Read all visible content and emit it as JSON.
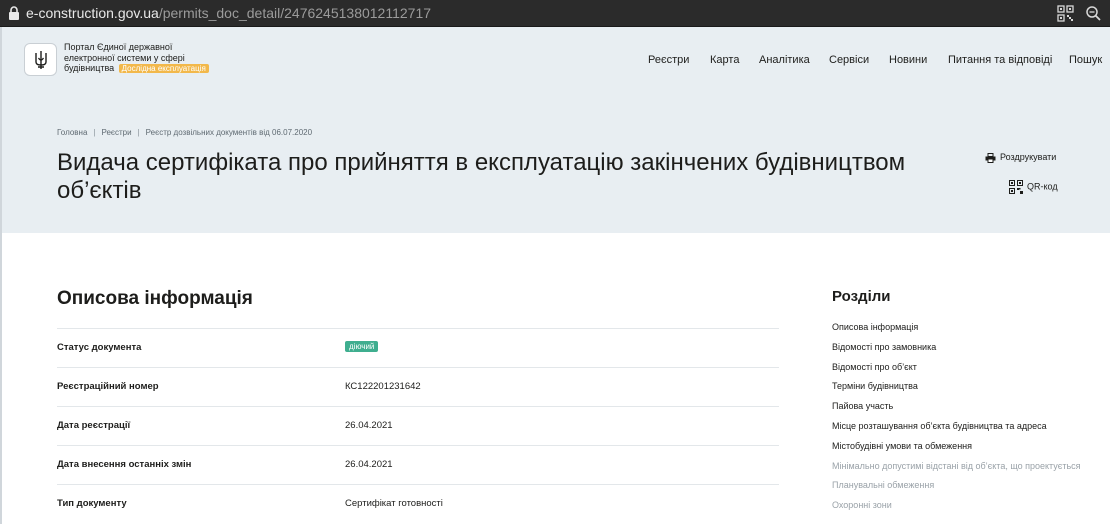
{
  "browser": {
    "url_host": "e-construction.gov.ua",
    "url_path": "/permits_doc_detail/2476245138012112717",
    "icons": [
      "lock-icon",
      "qr-scan-icon",
      "zoom-icon"
    ]
  },
  "header": {
    "portal_name": "Портал Єдиної державної електронної системи у сфері будівництва",
    "trial_badge": "Дослідна експлуатація",
    "nav": [
      "Реєстри",
      "Карта",
      "Аналітика",
      "Сервіси",
      "Новини",
      "Питання та відповіді",
      "Пошук"
    ]
  },
  "hero": {
    "breadcrumb": [
      "Головна",
      "Реєстри",
      "Реєстр дозвільних документів від 06.07.2020"
    ],
    "title": "Видача сертифіката про прийняття в експлуатацію закінчених будівництвом об’єктів",
    "print_label": "Роздрукувати",
    "qr_label": "QR-код"
  },
  "main": {
    "section_title": "Описова інформація",
    "rows": [
      {
        "key": "Статус документа",
        "value": "діючий"
      },
      {
        "key": "Реєстраційний номер",
        "value": "КС122201231642"
      },
      {
        "key": "Дата реєстрації",
        "value": "26.04.2021"
      },
      {
        "key": "Дата внесення останніх змін",
        "value": "26.04.2021"
      },
      {
        "key": "Тип документу",
        "value": "Сертифікат готовності"
      }
    ],
    "status_color": "#3fae8f"
  },
  "sidebar": {
    "title": "Розділи",
    "links": [
      {
        "label": "Описова інформація",
        "muted": false
      },
      {
        "label": "Відомості про замовника",
        "muted": false
      },
      {
        "label": "Відомості про об’єкт",
        "muted": false
      },
      {
        "label": "Терміни будівництва",
        "muted": false
      },
      {
        "label": "Пайова участь",
        "muted": false
      },
      {
        "label": "Місце розташування об’єкта будівництва та адреса",
        "muted": false
      },
      {
        "label": "Містобудівні умови та обмеження",
        "muted": false
      },
      {
        "label": "Мінімально допустимі відстані від об’єкта, що проектується",
        "muted": true
      },
      {
        "label": "Планувальні обмеження",
        "muted": true
      },
      {
        "label": "Охоронні зони",
        "muted": true
      }
    ]
  }
}
